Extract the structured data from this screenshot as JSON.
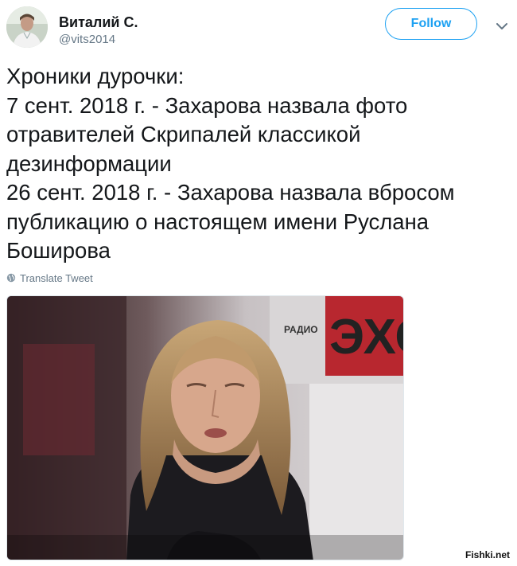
{
  "header": {
    "display_name": "Виталий С.",
    "handle": "@vits2014",
    "follow_label": "Follow"
  },
  "tweet": {
    "lines": [
      "Хроники дурочки:",
      "7 сент. 2018 г. - Захарова назвала фото",
      "отравителей Скрипалей классикой",
      "дезинформации",
      "26 сент. 2018 г. - Захарова назвала вбросом",
      "публикацию о настоящем имени Руслана",
      "Боширова"
    ],
    "translate_label": "Translate Tweet"
  },
  "media": {
    "sign_small": "РАДИО",
    "sign_large": "ЭХО"
  },
  "watermark": "Fishki.net",
  "colors": {
    "accent": "#1da1f2",
    "text": "#14171a",
    "secondary": "#657786"
  },
  "icons": {
    "caret": "chevron-down-icon",
    "translate": "globe-icon"
  }
}
